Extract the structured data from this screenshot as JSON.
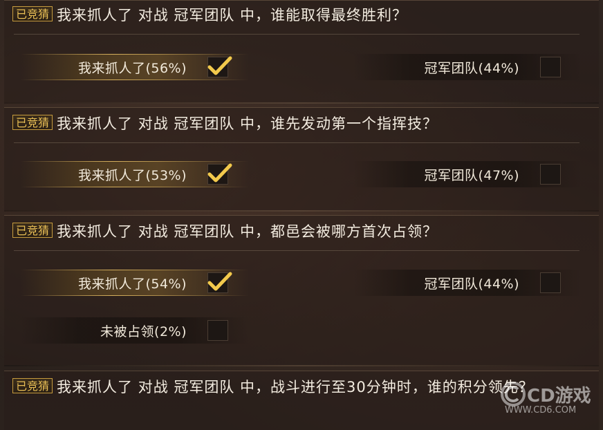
{
  "badge_label": "已竞猜",
  "questions": [
    {
      "text": "我来抓人了 对战 冠军团队 中，谁能取得最终胜利？",
      "options": [
        {
          "label": "我来抓人了(56%)",
          "checked": true
        },
        {
          "label": "冠军团队(44%)",
          "checked": false
        }
      ]
    },
    {
      "text": "我来抓人了 对战 冠军团队 中，谁先发动第一个指挥技？",
      "options": [
        {
          "label": "我来抓人了(53%)",
          "checked": true
        },
        {
          "label": "冠军团队(47%)",
          "checked": false
        }
      ]
    },
    {
      "text": "我来抓人了 对战 冠军团队 中，都邑会被哪方首次占领？",
      "options": [
        {
          "label": "我来抓人了(54%)",
          "checked": true
        },
        {
          "label": "冠军团队(44%)",
          "checked": false
        },
        {
          "label": "未被占领(2%)",
          "checked": false
        }
      ]
    },
    {
      "text": "我来抓人了 对战 冠军团队 中，战斗进行至30分钟时，谁的积分领先？",
      "options": []
    }
  ],
  "watermark": {
    "text": "CD游戏",
    "url": "WWW.CD6.COM"
  },
  "colors": {
    "accent_gold": "#e9bf55",
    "check": "#f2c94c"
  }
}
